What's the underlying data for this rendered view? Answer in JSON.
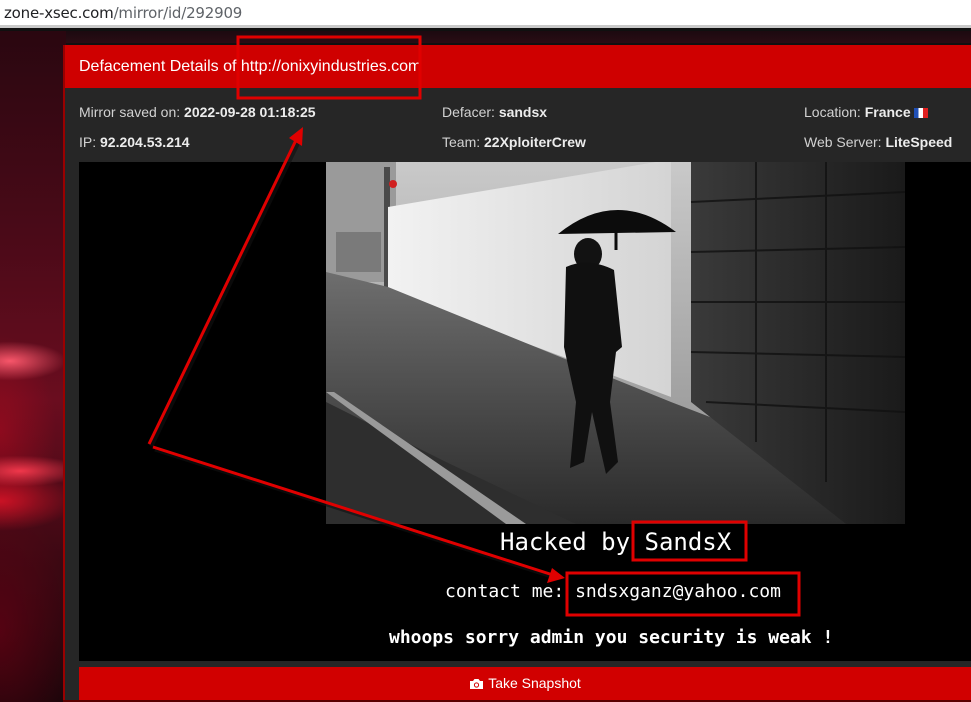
{
  "browser": {
    "url_host": "zone-xsec.com",
    "url_path": "/mirror/id/292909"
  },
  "panel": {
    "title_prefix": "Defacement Details of ",
    "site_url": "http://onixyindustries.com"
  },
  "details": {
    "mirror_saved_label": "Mirror saved on:",
    "mirror_saved_value": "2022-09-28 01:18:25",
    "defacer_label": "Defacer:",
    "defacer_value": "sandsx",
    "location_label": "Location:",
    "location_value": "France",
    "ip_label": "IP:",
    "ip_value": "92.204.53.214",
    "team_label": "Team:",
    "team_value": "22XploiterCrew",
    "webserver_label": "Web Server:",
    "webserver_value": "LiteSpeed"
  },
  "mirror": {
    "hacked_by_label": "Hacked by",
    "hacker_name": "SandsX",
    "contact_label": "contact me:",
    "contact_email": "sndsxganz@yahoo.com",
    "message": "whoops sorry admin you security is weak !"
  },
  "actions": {
    "snapshot_label": "Take Snapshot"
  },
  "icons": {
    "camera": "camera-icon",
    "flag": "flag-france-icon"
  },
  "colors": {
    "header_red": "#cf0000",
    "annotation_red": "#e00000",
    "panel_bg": "#262626"
  }
}
